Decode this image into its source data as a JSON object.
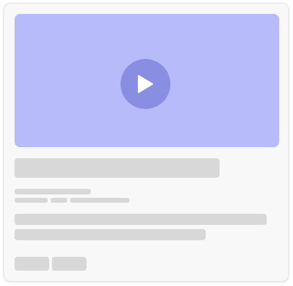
{
  "colors": {
    "card_background": "#f8f8f8",
    "card_border": "#e2e2e2",
    "video_background": "#b7bbfa",
    "play_button": "#8a8ee3",
    "play_icon": "#ffffff",
    "skeleton": "#d8d8d8"
  },
  "video": {
    "icon": "play-icon"
  }
}
